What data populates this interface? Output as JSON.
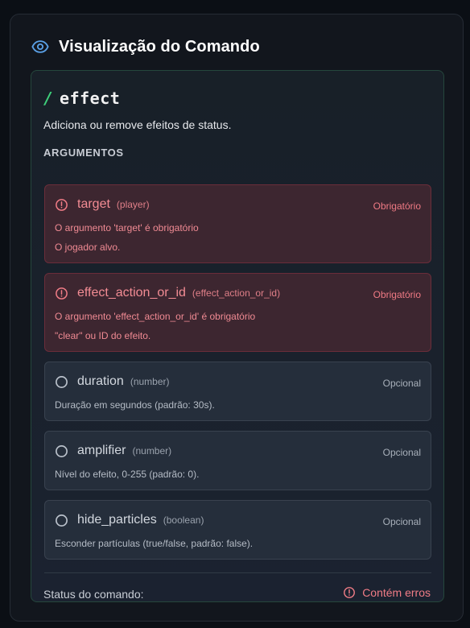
{
  "header": {
    "title": "Visualização do Comando",
    "icon": "eye-icon"
  },
  "command": {
    "name": "effect",
    "description": "Adiciona ou remove efeitos de status.",
    "arguments_label": "ARGUMENTOS"
  },
  "arguments": [
    {
      "name": "target",
      "type": "(player)",
      "tag": "Obrigatório",
      "state": "error",
      "error": "O argumento 'target' é obrigatório",
      "description": "O jogador alvo."
    },
    {
      "name": "effect_action_or_id",
      "type": "(effect_action_or_id)",
      "tag": "Obrigatório",
      "state": "error",
      "error": "O argumento 'effect_action_or_id' é obrigatório",
      "description": "\"clear\" ou ID do efeito."
    },
    {
      "name": "duration",
      "type": "(number)",
      "tag": "Opcional",
      "state": "ok",
      "description": "Duração em segundos (padrão: 30s)."
    },
    {
      "name": "amplifier",
      "type": "(number)",
      "tag": "Opcional",
      "state": "ok",
      "description": "Nível do efeito, 0-255 (padrão: 0)."
    },
    {
      "name": "hide_particles",
      "type": "(boolean)",
      "tag": "Opcional",
      "state": "ok",
      "description": "Esconder partículas (true/false, padrão: false)."
    }
  ],
  "status": {
    "label": "Status do comando:",
    "value": "Contém erros",
    "icon": "alert-circle-icon"
  },
  "colors": {
    "accent_green": "#3ecf7a",
    "error_red": "#f07c86",
    "eye_blue": "#5aa0e6"
  }
}
